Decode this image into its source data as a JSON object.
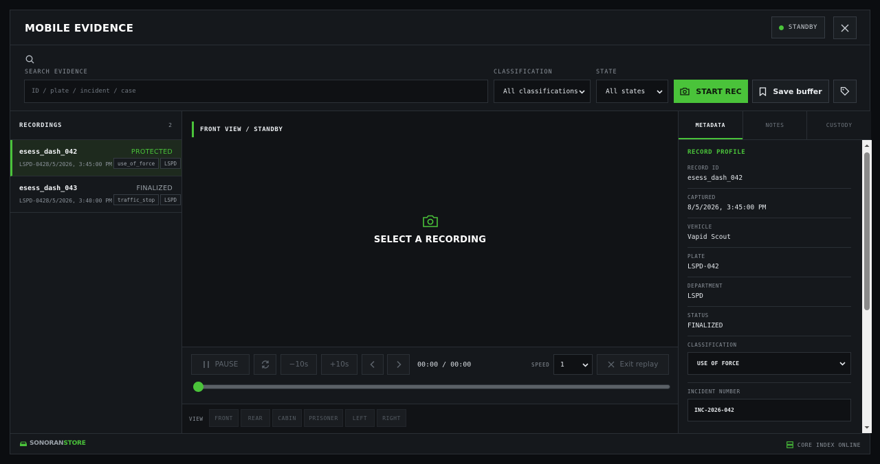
{
  "header": {
    "title": "MOBILE EVIDENCE",
    "status": "STANDBY"
  },
  "search": {
    "label": "SEARCH EVIDENCE",
    "placeholder": "ID / plate / incident / case",
    "classification_label": "CLASSIFICATION",
    "classification_value": "All classifications",
    "state_label": "STATE",
    "state_value": "All states",
    "start_rec": "START REC",
    "save_buffer": "Save buffer"
  },
  "recordings": {
    "title": "RECORDINGS",
    "count": "2",
    "items": [
      {
        "id": "esess_dash_042",
        "status": "PROTECTED",
        "meta": "LSPD-0428/5/2026, 3:45:00 PM",
        "tag": "use_of_force",
        "dept": "LSPD"
      },
      {
        "id": "esess_dash_043",
        "status": "FINALIZED",
        "meta": "LSPD-0428/5/2026, 3:40:00 PM",
        "tag": "traffic_stop",
        "dept": "LSPD"
      }
    ]
  },
  "viewer": {
    "header": "FRONT VIEW / STANDBY",
    "empty": "SELECT A RECORDING",
    "pause": "PAUSE",
    "back10": "−10s",
    "fwd10": "+10s",
    "time": "00:00 / 00:00",
    "speed_label": "SPEED",
    "speed_value": "1",
    "exit_replay": "Exit replay",
    "progress": 0,
    "view_label": "VIEW",
    "views": [
      "FRONT",
      "REAR",
      "CABIN",
      "PRISONER",
      "LEFT",
      "RIGHT"
    ]
  },
  "metadata": {
    "tabs": [
      "METADATA",
      "NOTES",
      "CUSTODY"
    ],
    "section": "RECORD PROFILE",
    "fields": [
      {
        "key": "RECORD ID",
        "value": "esess_dash_042"
      },
      {
        "key": "CAPTURED",
        "value": "8/5/2026, 3:45:00 PM"
      },
      {
        "key": "VEHICLE",
        "value": "Vapid Scout"
      },
      {
        "key": "PLATE",
        "value": "LSPD-042"
      },
      {
        "key": "DEPARTMENT",
        "value": "LSPD"
      },
      {
        "key": "STATUS",
        "value": "FINALIZED"
      }
    ],
    "classification_label": "CLASSIFICATION",
    "classification_value": "USE OF FORCE",
    "incident_label": "INCIDENT NUMBER",
    "incident_value": "INC-2026-042"
  },
  "footer": {
    "brand_a": "SONORAN",
    "brand_b": "STORE",
    "status": "CORE INDEX ONLINE"
  },
  "colors": {
    "accent": "#4ac33a",
    "protected": "#4ac33a",
    "finalized": "#9aa1a8"
  }
}
